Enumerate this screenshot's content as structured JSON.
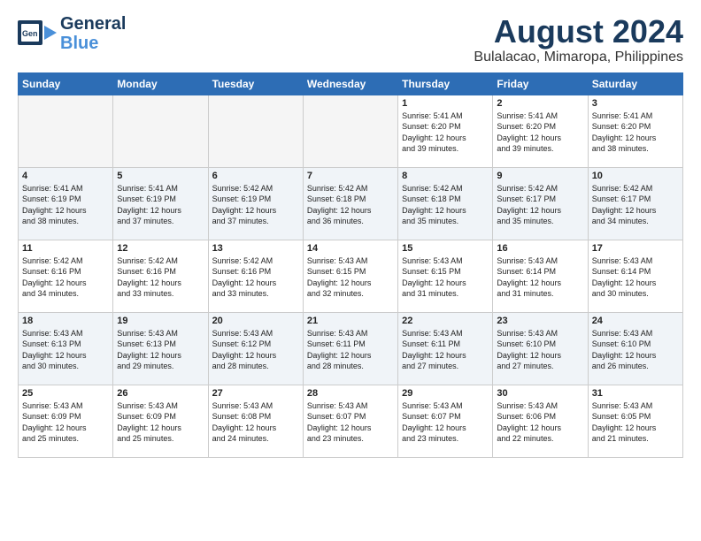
{
  "header": {
    "logo_general": "General",
    "logo_blue": "Blue",
    "month_title": "August 2024",
    "location": "Bulalacao, Mimaropa, Philippines"
  },
  "weekdays": [
    "Sunday",
    "Monday",
    "Tuesday",
    "Wednesday",
    "Thursday",
    "Friday",
    "Saturday"
  ],
  "weeks": [
    [
      {
        "day": "",
        "info": "",
        "empty": true
      },
      {
        "day": "",
        "info": "",
        "empty": true
      },
      {
        "day": "",
        "info": "",
        "empty": true
      },
      {
        "day": "",
        "info": "",
        "empty": true
      },
      {
        "day": "1",
        "info": "Sunrise: 5:41 AM\nSunset: 6:20 PM\nDaylight: 12 hours\nand 39 minutes."
      },
      {
        "day": "2",
        "info": "Sunrise: 5:41 AM\nSunset: 6:20 PM\nDaylight: 12 hours\nand 39 minutes."
      },
      {
        "day": "3",
        "info": "Sunrise: 5:41 AM\nSunset: 6:20 PM\nDaylight: 12 hours\nand 38 minutes."
      }
    ],
    [
      {
        "day": "4",
        "info": "Sunrise: 5:41 AM\nSunset: 6:19 PM\nDaylight: 12 hours\nand 38 minutes."
      },
      {
        "day": "5",
        "info": "Sunrise: 5:41 AM\nSunset: 6:19 PM\nDaylight: 12 hours\nand 37 minutes."
      },
      {
        "day": "6",
        "info": "Sunrise: 5:42 AM\nSunset: 6:19 PM\nDaylight: 12 hours\nand 37 minutes."
      },
      {
        "day": "7",
        "info": "Sunrise: 5:42 AM\nSunset: 6:18 PM\nDaylight: 12 hours\nand 36 minutes."
      },
      {
        "day": "8",
        "info": "Sunrise: 5:42 AM\nSunset: 6:18 PM\nDaylight: 12 hours\nand 35 minutes."
      },
      {
        "day": "9",
        "info": "Sunrise: 5:42 AM\nSunset: 6:17 PM\nDaylight: 12 hours\nand 35 minutes."
      },
      {
        "day": "10",
        "info": "Sunrise: 5:42 AM\nSunset: 6:17 PM\nDaylight: 12 hours\nand 34 minutes."
      }
    ],
    [
      {
        "day": "11",
        "info": "Sunrise: 5:42 AM\nSunset: 6:16 PM\nDaylight: 12 hours\nand 34 minutes."
      },
      {
        "day": "12",
        "info": "Sunrise: 5:42 AM\nSunset: 6:16 PM\nDaylight: 12 hours\nand 33 minutes."
      },
      {
        "day": "13",
        "info": "Sunrise: 5:42 AM\nSunset: 6:16 PM\nDaylight: 12 hours\nand 33 minutes."
      },
      {
        "day": "14",
        "info": "Sunrise: 5:43 AM\nSunset: 6:15 PM\nDaylight: 12 hours\nand 32 minutes."
      },
      {
        "day": "15",
        "info": "Sunrise: 5:43 AM\nSunset: 6:15 PM\nDaylight: 12 hours\nand 31 minutes."
      },
      {
        "day": "16",
        "info": "Sunrise: 5:43 AM\nSunset: 6:14 PM\nDaylight: 12 hours\nand 31 minutes."
      },
      {
        "day": "17",
        "info": "Sunrise: 5:43 AM\nSunset: 6:14 PM\nDaylight: 12 hours\nand 30 minutes."
      }
    ],
    [
      {
        "day": "18",
        "info": "Sunrise: 5:43 AM\nSunset: 6:13 PM\nDaylight: 12 hours\nand 30 minutes."
      },
      {
        "day": "19",
        "info": "Sunrise: 5:43 AM\nSunset: 6:13 PM\nDaylight: 12 hours\nand 29 minutes."
      },
      {
        "day": "20",
        "info": "Sunrise: 5:43 AM\nSunset: 6:12 PM\nDaylight: 12 hours\nand 28 minutes."
      },
      {
        "day": "21",
        "info": "Sunrise: 5:43 AM\nSunset: 6:11 PM\nDaylight: 12 hours\nand 28 minutes."
      },
      {
        "day": "22",
        "info": "Sunrise: 5:43 AM\nSunset: 6:11 PM\nDaylight: 12 hours\nand 27 minutes."
      },
      {
        "day": "23",
        "info": "Sunrise: 5:43 AM\nSunset: 6:10 PM\nDaylight: 12 hours\nand 27 minutes."
      },
      {
        "day": "24",
        "info": "Sunrise: 5:43 AM\nSunset: 6:10 PM\nDaylight: 12 hours\nand 26 minutes."
      }
    ],
    [
      {
        "day": "25",
        "info": "Sunrise: 5:43 AM\nSunset: 6:09 PM\nDaylight: 12 hours\nand 25 minutes."
      },
      {
        "day": "26",
        "info": "Sunrise: 5:43 AM\nSunset: 6:09 PM\nDaylight: 12 hours\nand 25 minutes."
      },
      {
        "day": "27",
        "info": "Sunrise: 5:43 AM\nSunset: 6:08 PM\nDaylight: 12 hours\nand 24 minutes."
      },
      {
        "day": "28",
        "info": "Sunrise: 5:43 AM\nSunset: 6:07 PM\nDaylight: 12 hours\nand 23 minutes."
      },
      {
        "day": "29",
        "info": "Sunrise: 5:43 AM\nSunset: 6:07 PM\nDaylight: 12 hours\nand 23 minutes."
      },
      {
        "day": "30",
        "info": "Sunrise: 5:43 AM\nSunset: 6:06 PM\nDaylight: 12 hours\nand 22 minutes."
      },
      {
        "day": "31",
        "info": "Sunrise: 5:43 AM\nSunset: 6:05 PM\nDaylight: 12 hours\nand 21 minutes."
      }
    ]
  ]
}
